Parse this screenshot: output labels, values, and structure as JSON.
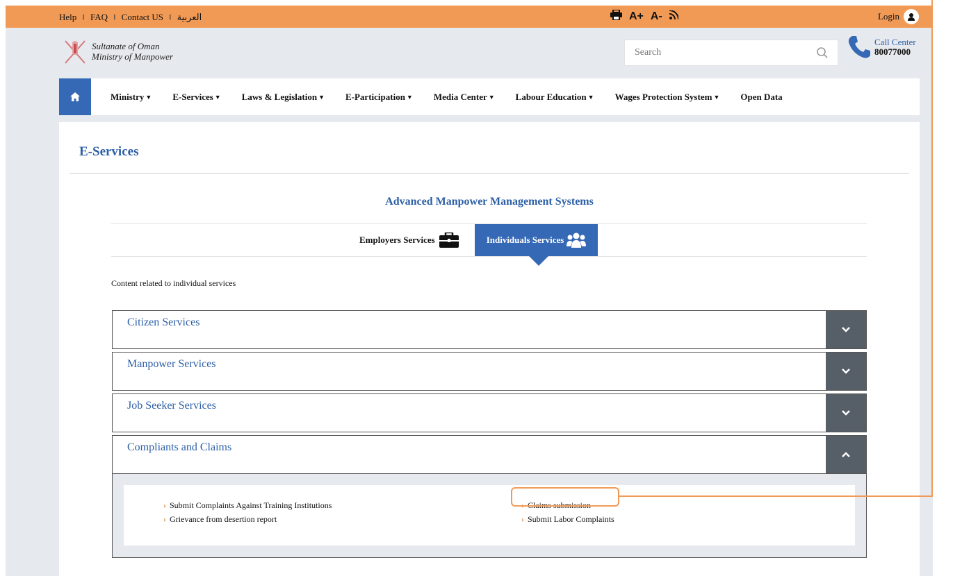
{
  "topbar": {
    "links": [
      "Help",
      "FAQ",
      "Contact US",
      "العربية"
    ],
    "separator": "I",
    "font_increase": "A+",
    "font_decrease": "A-",
    "login_label": "Login"
  },
  "header": {
    "logo_line1": "Sultanate of Oman",
    "logo_line2": "Ministry of Manpower",
    "search_placeholder": "Search",
    "call_center_label": "Call Center",
    "call_center_number": "80077000"
  },
  "nav": {
    "items": [
      {
        "label": "Ministry",
        "dropdown": true
      },
      {
        "label": "E-Services",
        "dropdown": true
      },
      {
        "label": "Laws & Legislation",
        "dropdown": true
      },
      {
        "label": "E-Participation",
        "dropdown": true
      },
      {
        "label": "Media Center",
        "dropdown": true
      },
      {
        "label": "Labour Education",
        "dropdown": true
      },
      {
        "label": "Wages Protection System",
        "dropdown": true
      },
      {
        "label": "Open Data",
        "dropdown": false
      }
    ]
  },
  "page": {
    "title": "E-Services",
    "section_title": "Advanced Manpower Management Systems",
    "tabs": {
      "employers": "Employers Services",
      "individuals": "Individuals Services",
      "active": "individuals"
    },
    "intro": "Content related to individual services",
    "accordion": [
      {
        "label": "Citizen Services",
        "expanded": false
      },
      {
        "label": "Manpower Services",
        "expanded": false
      },
      {
        "label": "Job Seeker Services",
        "expanded": false
      },
      {
        "label": "Compliants and Claims",
        "expanded": true
      }
    ],
    "claims_links": {
      "col1": [
        "Submit Complaints Against Training Institutions",
        "Grievance from desertion report"
      ],
      "col2": [
        "Claims submission",
        "Submit Labor Complaints"
      ]
    }
  },
  "colors": {
    "topbar": "#f19a56",
    "primary_blue": "#3568b5",
    "toggle_gray": "#565e68",
    "link_chevron": "#e2812f",
    "highlight": "#f19a56"
  },
  "icons": {
    "print": "print-icon",
    "rss": "rss-icon",
    "user": "user-icon",
    "search": "search-icon",
    "phone": "phone-icon",
    "home": "home-icon",
    "briefcase": "briefcase-icon",
    "people": "people-icon"
  }
}
